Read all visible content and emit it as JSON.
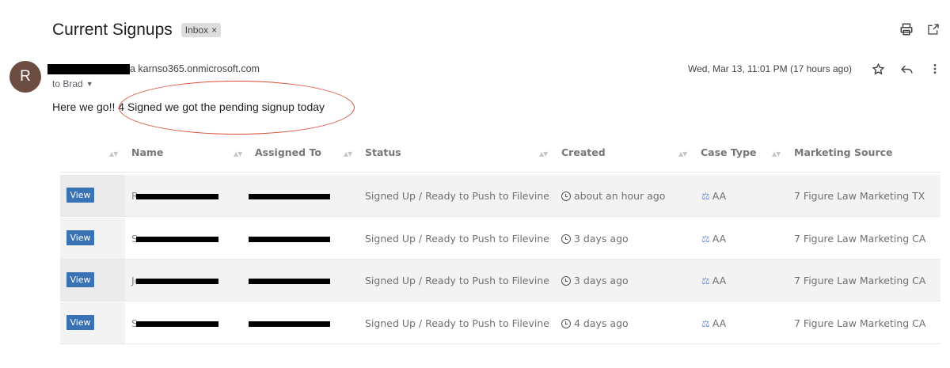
{
  "email": {
    "subject": "Current Signups",
    "label": "Inbox",
    "label_close": "×",
    "avatar_initial": "R",
    "sender_domain": "a karnso365.onmicrosoft.com",
    "recipient": "to Brad",
    "date": "Wed, Mar 13, 11:01 PM (17 hours ago)",
    "body_prefix": "Here we go!! ",
    "body_highlight": "4 Signed we got the pending signup today",
    "colors": {
      "avatar": "#6d4c41",
      "circle": "#d94a33",
      "view_button": "#3a72b6"
    },
    "icons": [
      "print-icon",
      "open-in-new-window-icon",
      "star-icon",
      "reply-icon",
      "more-vert-icon"
    ]
  },
  "table": {
    "headers": [
      "Name",
      "Assigned To",
      "Status",
      "Created",
      "Case Type",
      "Marketing Source"
    ],
    "view_label": "View",
    "rows": [
      {
        "name_visible": "R",
        "assigned_visible": "",
        "status": "Signed Up / Ready to Push to Filevine",
        "created": "about an hour ago",
        "case_type": "AA",
        "source": "7 Figure Law Marketing TX"
      },
      {
        "name_visible": "S",
        "assigned_visible": "",
        "status": "Signed Up / Ready to Push to Filevine",
        "created": "3 days ago",
        "case_type": "AA",
        "source": "7 Figure Law Marketing CA"
      },
      {
        "name_visible": "Jo",
        "assigned_visible": "",
        "status": "Signed Up / Ready to Push to Filevine",
        "created": "3 days ago",
        "case_type": "AA",
        "source": "7 Figure Law Marketing CA"
      },
      {
        "name_visible": "S",
        "assigned_visible": "",
        "status": "Signed Up / Ready to Push to Filevine",
        "created": "4 days ago",
        "case_type": "AA",
        "source": "7 Figure Law Marketing CA"
      }
    ]
  }
}
